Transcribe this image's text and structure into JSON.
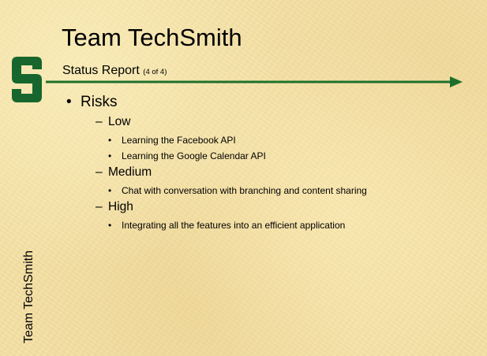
{
  "slide": {
    "title": "Team TechSmith",
    "subtitle": "Status Report",
    "page_count": "(4 of 4)",
    "side_label": "Team TechSmith",
    "logo_letter": "S",
    "accent_color": "#1e6f2b",
    "logo_color": "#17662d"
  },
  "outline": {
    "heading": "Risks",
    "groups": [
      {
        "level": "Low",
        "items": [
          "Learning the Facebook API",
          "Learning the Google Calendar API"
        ]
      },
      {
        "level": "Medium",
        "items": [
          "Chat with conversation with branching and content sharing"
        ]
      },
      {
        "level": "High",
        "items": [
          "Integrating all the features into an efficient application"
        ]
      }
    ]
  }
}
